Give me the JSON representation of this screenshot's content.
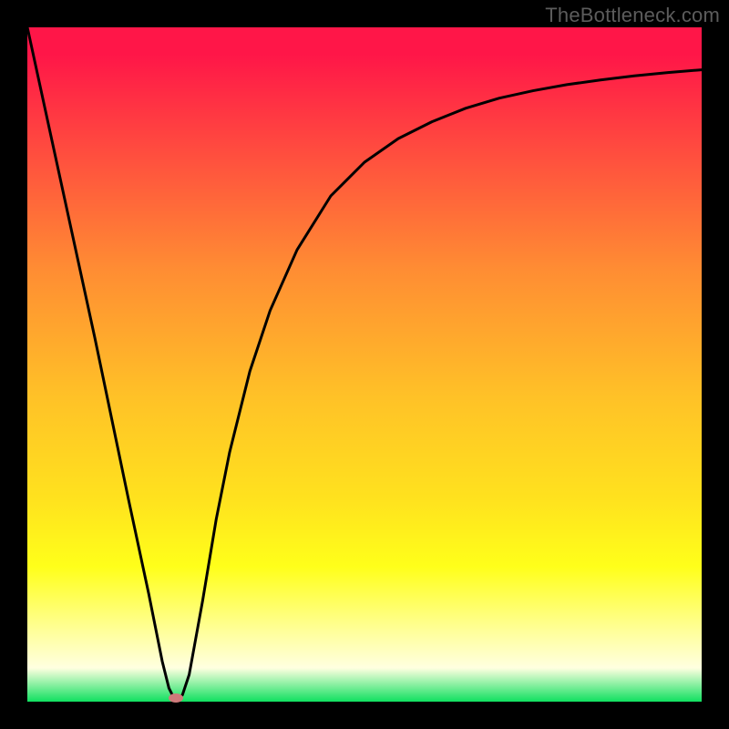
{
  "watermark": "TheBottleneck.com",
  "chart_data": {
    "type": "line",
    "title": "",
    "xlabel": "",
    "ylabel": "",
    "xlim": [
      0,
      100
    ],
    "ylim": [
      0,
      100
    ],
    "grid": false,
    "legend": false,
    "background_gradient": {
      "top": "#ff1648",
      "middle": "#ffe21e",
      "bottom": "#10e060"
    },
    "series": [
      {
        "name": "bottleneck-curve",
        "color": "#000000",
        "x": [
          0,
          5,
          10,
          15,
          18,
          20,
          21,
          22,
          23,
          24,
          26,
          28,
          30,
          33,
          36,
          40,
          45,
          50,
          55,
          60,
          65,
          70,
          75,
          80,
          85,
          90,
          95,
          100
        ],
        "values": [
          100,
          77,
          54,
          30,
          16,
          6,
          2,
          0,
          1,
          4,
          15,
          27,
          37,
          49,
          58,
          67,
          75,
          80,
          83.5,
          86,
          88,
          89.5,
          90.6,
          91.5,
          92.2,
          92.8,
          93.3,
          93.7
        ]
      }
    ],
    "marker": {
      "x": 22,
      "y": 0.5,
      "color": "#cf7a7b"
    }
  }
}
